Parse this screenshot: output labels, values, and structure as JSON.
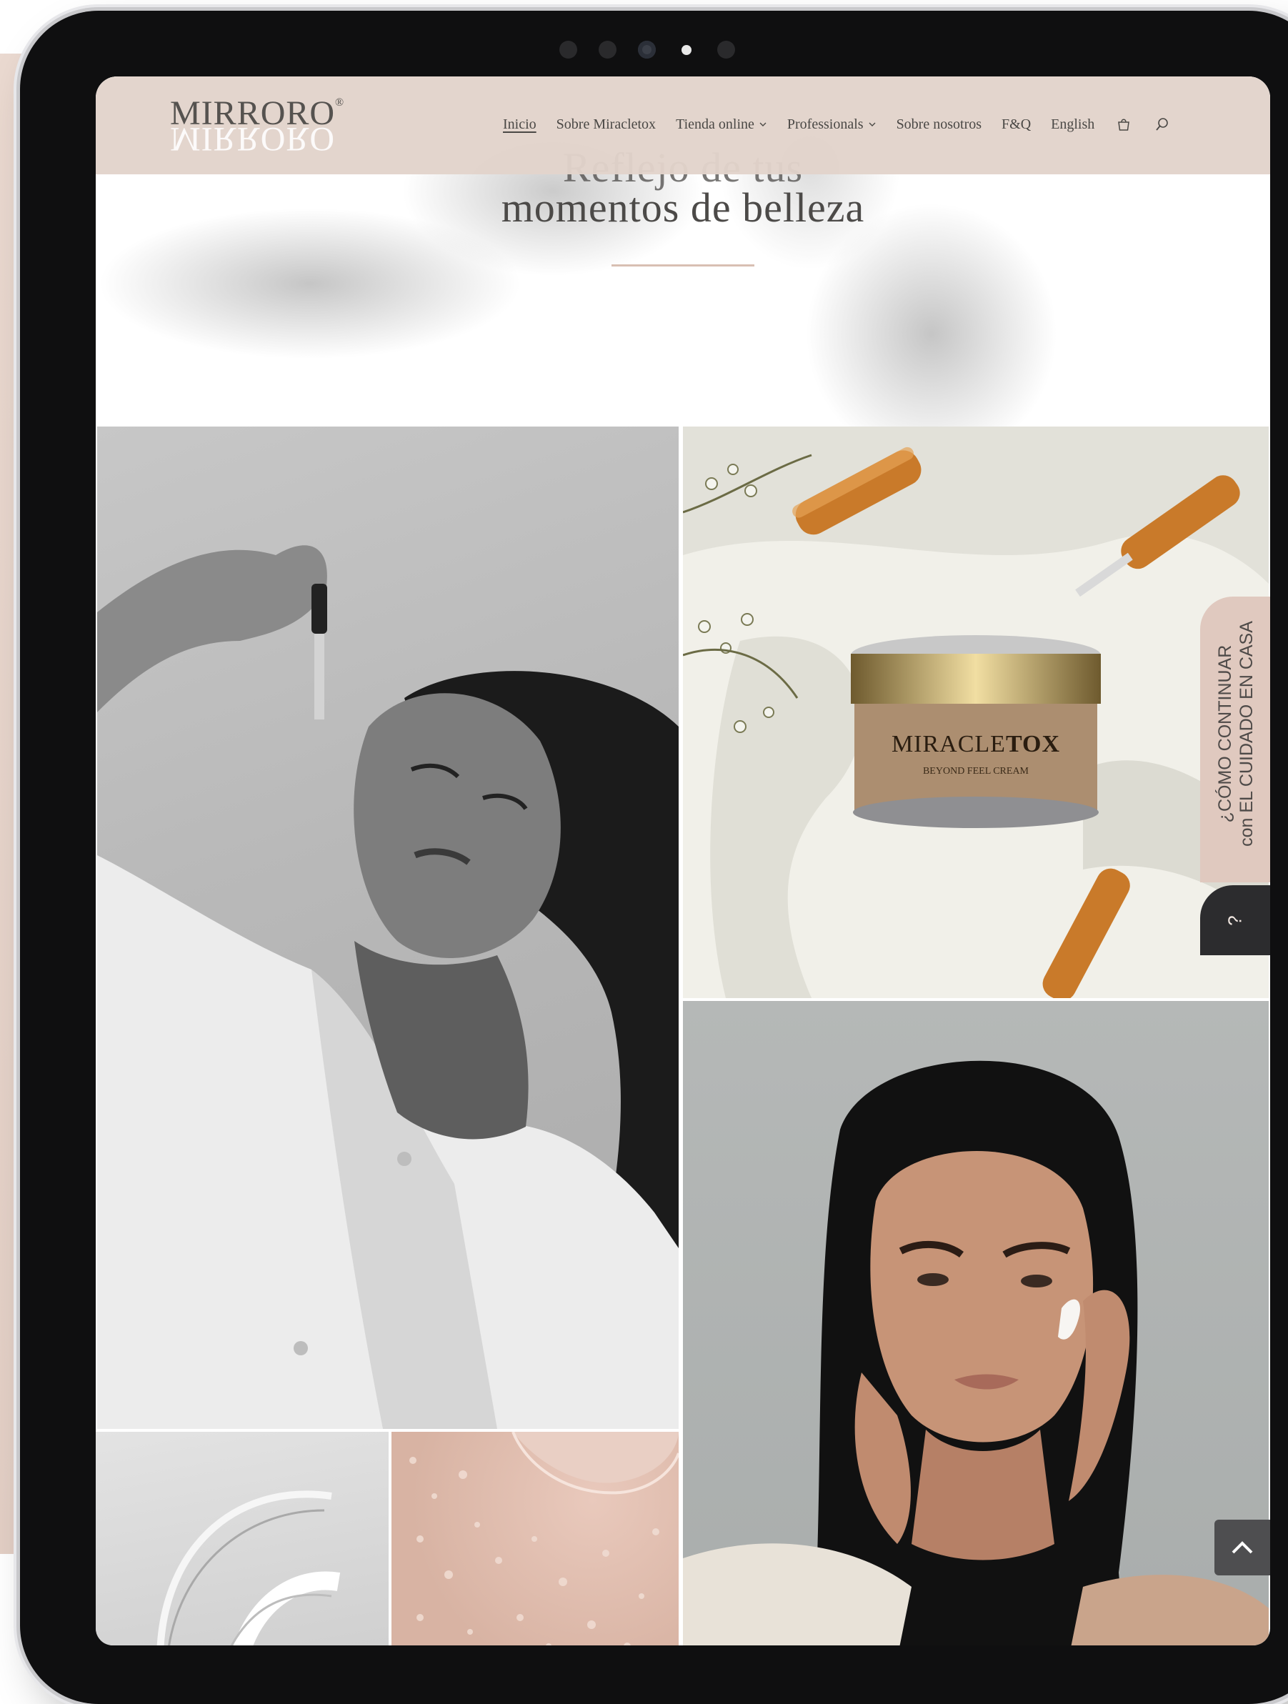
{
  "brand": {
    "logo_text": "MIRRORO",
    "logo_mark": "®"
  },
  "nav": {
    "items": [
      {
        "label": "Inicio",
        "active": true
      },
      {
        "label": "Sobre Miracletox"
      },
      {
        "label": "Tienda online",
        "dropdown": true
      },
      {
        "label": "Professionals",
        "dropdown": true
      },
      {
        "label": "Sobre nosotros"
      },
      {
        "label": "F&Q"
      },
      {
        "label": "English"
      }
    ],
    "cart_icon": "shopping-bag-icon",
    "search_icon": "search-icon"
  },
  "hero": {
    "title_line1": "Reflejo de tus",
    "title_line2": "momentos de belleza"
  },
  "gallery": {
    "product_label": "MIRACLETOX",
    "product_label_light": "MIRACLE",
    "product_label_bold": "TOX",
    "product_sublabel": "BEYOND FEEL CREAM"
  },
  "side_tab": {
    "line1": "¿CÓMO CONTINUAR",
    "line2": "con EL CUIDADO EN CASA",
    "help_symbol": "?"
  },
  "colors": {
    "header_bg": "#e2d3cb",
    "accent_rule": "#d8bfb2",
    "side_tab_bg": "#e0c9bf",
    "dark_button": "#2c2c2e"
  }
}
